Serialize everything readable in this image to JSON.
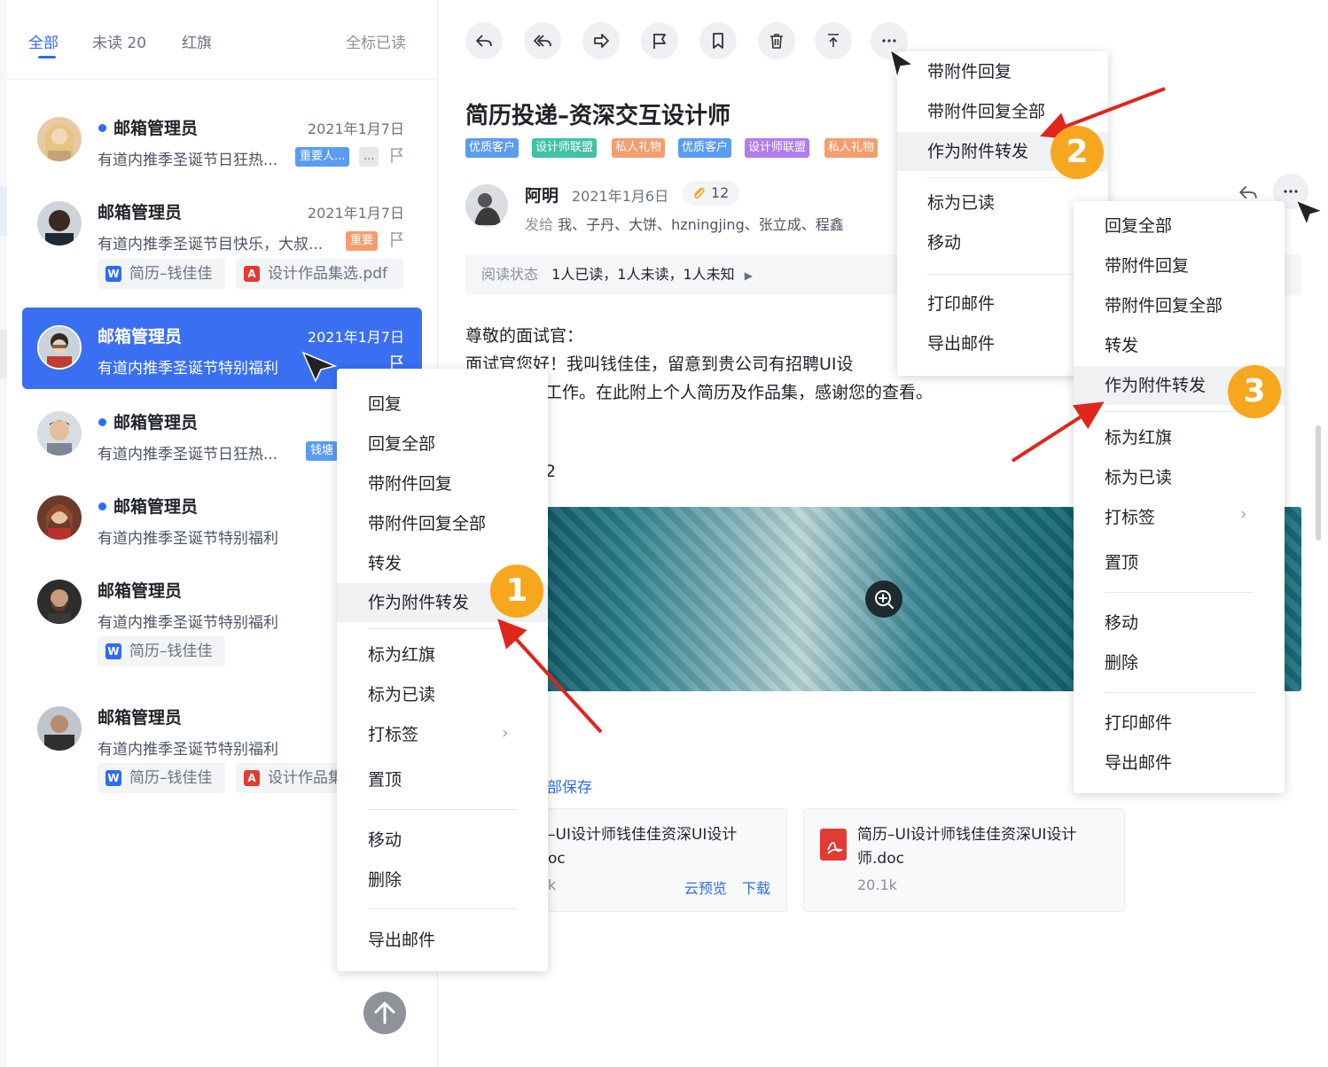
{
  "list": {
    "tabs": [
      "全部",
      "未读 20",
      "红旗"
    ],
    "mark_all": "全标已读",
    "items": [
      {
        "sender": "邮箱管理员",
        "date": "2021年1月7日",
        "preview": "有道内推季圣诞节日狂热...",
        "badge": "重要人...",
        "more": "..."
      },
      {
        "sender": "邮箱管理员",
        "date": "2021年1月7日",
        "preview": "有道内推季圣诞节目快乐，大叔...",
        "badge": "重要",
        "att1": "简历–钱佳佳",
        "att2": "设计作品集选.pdf"
      },
      {
        "sender": "邮箱管理员",
        "date": "2021年1月7日",
        "preview": "有道内推季圣诞节特别福利"
      },
      {
        "sender": "邮箱管理员",
        "date": "202",
        "preview": "有道内推季圣诞节日狂热...",
        "badge": "钱塘"
      },
      {
        "sender": "邮箱管理员",
        "date": "202",
        "preview": "有道内推季圣诞节特别福利"
      },
      {
        "sender": "邮箱管理员",
        "date": "202",
        "preview": "有道内推季圣诞节特别福利",
        "att1": "简历–钱佳佳"
      },
      {
        "sender": "邮箱管理员",
        "date": "202",
        "preview": "有道内推季圣诞节特别福利",
        "att1": "简历–钱佳佳",
        "att2": "设计作品集"
      }
    ]
  },
  "mail": {
    "subject": "简历投递–资深交互设计师",
    "tags": [
      "优质客户",
      "设计师联盟",
      "私人礼物",
      "优质客户",
      "设计师联盟",
      "私人礼物"
    ],
    "sender": "阿明",
    "date": "2021年1月6日",
    "attach_count": "12",
    "to_label": "发给",
    "recipients": "我、子丹、大饼、hzningjing、张立成、程鑫",
    "read_label": "阅读状态",
    "read_value": "1人已读，1人未读，1人未知",
    "greeting": "尊敬的面试官：",
    "line1": "面试官您好！我叫钱佳佳，留意到贵公司有招聘UI设",
    "line2": "工作。在此附上个人简历及作品集，感谢您的查看。",
    "line3": "2",
    "save_all": "部保存",
    "attachments": [
      {
        "name": "–UI设计师钱佳佳资深UI设计",
        "ext": "oc",
        "size": "k",
        "preview": "云预览",
        "download": "下载"
      },
      {
        "name": "简历–UI设计师钱佳佳资深UI设计",
        "ext": "师.doc",
        "size": "20.1k"
      }
    ]
  },
  "menu1": {
    "items": [
      "回复",
      "回复全部",
      "带附件回复",
      "带附件回复全部",
      "转发",
      "作为附件转发",
      "标为红旗",
      "标为已读",
      "打标签",
      "置顶",
      "移动",
      "删除",
      "导出邮件"
    ]
  },
  "menu2": {
    "items": [
      "带附件回复",
      "带附件回复全部",
      "作为附件转发",
      "标为已读",
      "移动",
      "打印邮件",
      "导出邮件"
    ]
  },
  "menu3": {
    "items": [
      "回复全部",
      "带附件回复",
      "带附件回复全部",
      "转发",
      "作为附件转发",
      "标为红旗",
      "标为已读",
      "打标签",
      "置顶",
      "移动",
      "删除",
      "打印邮件",
      "导出邮件"
    ]
  },
  "steps": [
    "1",
    "2",
    "3"
  ],
  "colors": {
    "accent": "#2f6bf2",
    "selected": "#3a6ff2",
    "step": "#f7a71e",
    "arrow": "#e0251b",
    "tag_blue": "#5b9cf2",
    "tag_green": "#41c2a6",
    "tag_orange": "#f59d6e",
    "tag_purple": "#b07cf0"
  }
}
